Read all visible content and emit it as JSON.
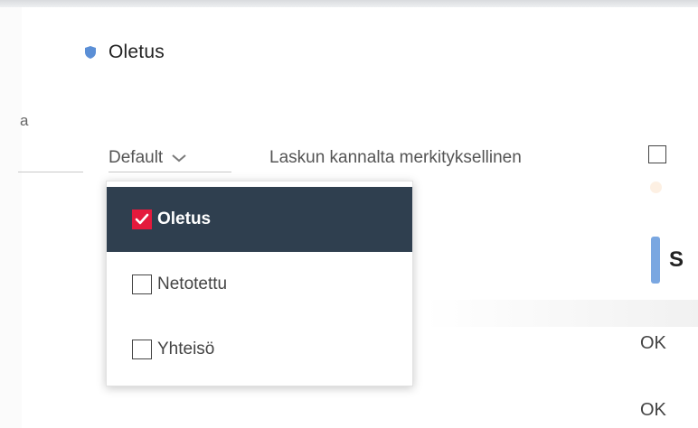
{
  "header": {
    "title": "Oletus",
    "icon": "shield-icon",
    "icon_color": "#5b8fd6"
  },
  "form": {
    "partial_label": "a",
    "type_select": {
      "value": "Default",
      "icon": "chevron-down-icon"
    },
    "invoice_relevant": {
      "label": "Laskun kannalta merkityksellinen",
      "checked": false
    }
  },
  "dropdown": {
    "options": [
      {
        "label": "Oletus",
        "checked": true
      },
      {
        "label": "Netotettu",
        "checked": false
      },
      {
        "label": "Yhteisö",
        "checked": false
      }
    ]
  },
  "background_table": {
    "header_partial": "S",
    "header_accent_color": "#7aa7e1",
    "status_values": [
      "OK",
      "OK"
    ]
  },
  "colors": {
    "selected_row_bg": "#2f3f4f",
    "checked_box": "#e41a3c"
  }
}
